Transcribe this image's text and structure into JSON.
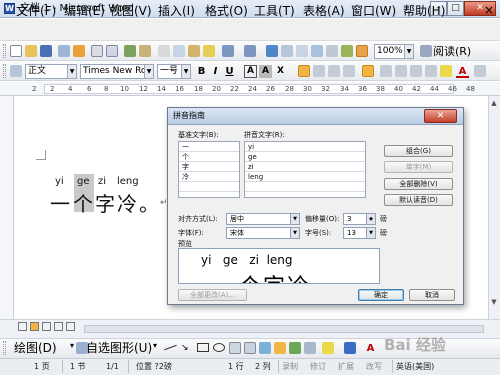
{
  "window": {
    "title": "文档 1 - Microsoft Word",
    "min_label": "–",
    "max_label": "□",
    "close_label": "✕"
  },
  "menu": [
    "文件(F)",
    "编辑(E)",
    "视图(V)",
    "插入(I)",
    "格式(O)",
    "工具(T)",
    "表格(A)",
    "窗口(W)",
    "帮助(H)"
  ],
  "menu_close": "×",
  "toolbar": {
    "zoom": "100%",
    "read_label": "阅读(R)"
  },
  "format": {
    "style": "正文",
    "font": "Times New Roman",
    "size": "一号",
    "bold": "B",
    "italic": "I",
    "underline": "U",
    "font_color_letter": "A",
    "char_border": "A",
    "char_shading": "A",
    "font_scale": "X"
  },
  "ruler_numbers": [
    "2",
    "2",
    "4",
    "6",
    "8",
    "10",
    "12",
    "14",
    "16",
    "18",
    "20",
    "22",
    "24",
    "26",
    "28",
    "30",
    "32",
    "34",
    "36",
    "38",
    "40",
    "42",
    "44",
    "46",
    "48"
  ],
  "document": {
    "pinyin": [
      "yi",
      "ge",
      "zi",
      "leng"
    ],
    "hanzi": [
      "一",
      "个",
      "字",
      "冷",
      "。"
    ],
    "return_mark": "↵"
  },
  "dialog": {
    "title": "拼音指南",
    "close": "✕",
    "base_header": "基准文字(B):",
    "ruby_header": "拼音文字(R):",
    "rows": [
      {
        "base": "一",
        "ruby": "yi"
      },
      {
        "base": "个",
        "ruby": "ge"
      },
      {
        "base": "字",
        "ruby": "zi"
      },
      {
        "base": "冷",
        "ruby": "leng"
      },
      {
        "base": "",
        "ruby": ""
      }
    ],
    "btn_group": "组合(G)",
    "btn_single": "单字(M)",
    "btn_clear_all": "全部删除(V)",
    "btn_default": "默认读音(D)",
    "align_label": "对齐方式(L):",
    "align_value": "居中",
    "offset_label": "偏移量(O):",
    "offset_value": "3",
    "offset_unit": "磅",
    "font_label": "字体(F):",
    "font_value": "宋体",
    "size_label": "字号(S):",
    "size_value": "13",
    "size_unit": "磅",
    "preview_label": "预览",
    "preview_pinyin": "yi   ge   zi  leng",
    "preview_hanzi": "一个字冷",
    "btn_change_all": "全部更改(A)...",
    "btn_ok": "确定",
    "btn_cancel": "取消"
  },
  "drawbar": {
    "draw_label": "绘图(D)",
    "autoshape_label": "自选图形(U)"
  },
  "status": {
    "page": "1 页",
    "section": "1 节",
    "pages": "1/1",
    "position": "位置 ?2磅",
    "line": "1 行",
    "column": "2 列",
    "rec": "录制",
    "track": "修订",
    "ext": "扩展",
    "ovr": "改写",
    "lang": "英语(美国)"
  },
  "watermark": "Bai 经验"
}
